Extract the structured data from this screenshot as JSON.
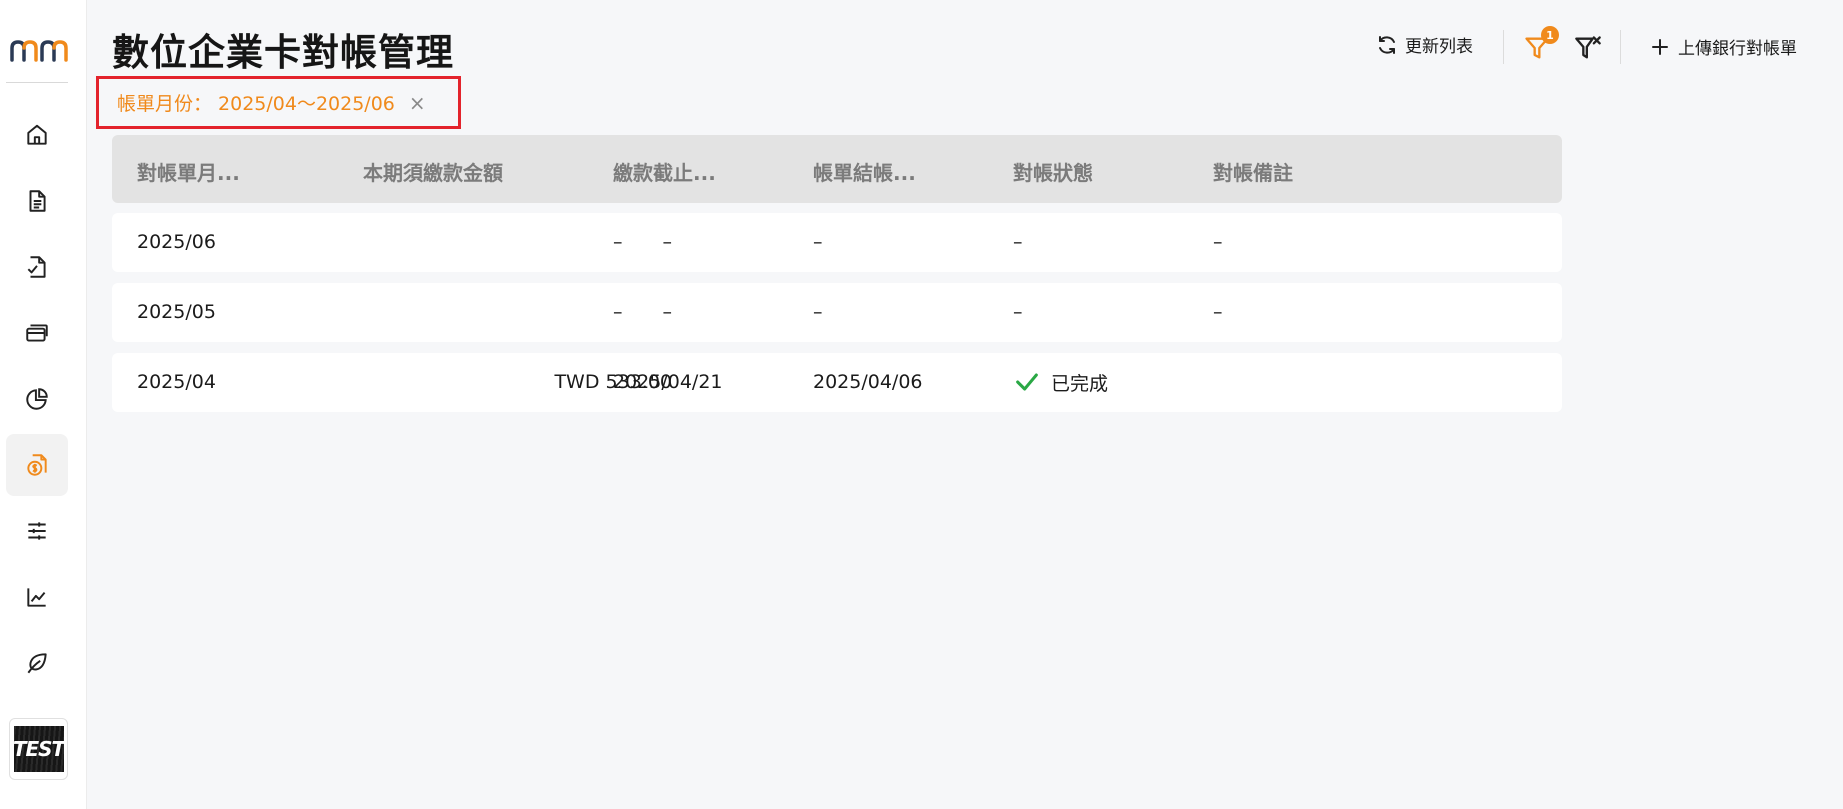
{
  "sidebar": {
    "logo_icon": "mm-logo",
    "items": [
      {
        "icon": "home-icon"
      },
      {
        "icon": "document-icon"
      },
      {
        "icon": "document-check-icon"
      },
      {
        "icon": "cards-icon"
      },
      {
        "icon": "pie-chart-icon"
      },
      {
        "icon": "dollar-document-icon",
        "active": true
      },
      {
        "icon": "sliders-icon"
      },
      {
        "icon": "line-chart-icon"
      },
      {
        "icon": "leaf-icon"
      }
    ],
    "avatar_text": "TEST"
  },
  "header": {
    "title": "數位企業卡對帳管理"
  },
  "toolbar": {
    "refresh_label": "更新列表",
    "filter_count": "1",
    "upload_label": "上傳銀行對帳單"
  },
  "filter_chip": {
    "label": "帳單月份：",
    "value": "2025/04～2025/06",
    "close": "×"
  },
  "table": {
    "columns": [
      "對帳單月...",
      "本期須繳款金額",
      "繳款截止...",
      "帳單結帳...",
      "對帳狀態",
      "對帳備註"
    ],
    "rows": [
      {
        "month": "2025/06",
        "amount": "–",
        "due": "–",
        "closing": "–",
        "status": "–",
        "note": "–"
      },
      {
        "month": "2025/05",
        "amount": "–",
        "due": "–",
        "closing": "–",
        "status": "–",
        "note": "–"
      },
      {
        "month": "2025/04",
        "amount": "TWD 533.00",
        "due": "2025/04/21",
        "closing": "2025/04/06",
        "status": "已完成",
        "note": ""
      }
    ]
  },
  "colors": {
    "accent": "#f08a1c",
    "highlight_frame": "#e3232c",
    "success": "#2aa845",
    "header_bg": "#e3e3e3"
  }
}
